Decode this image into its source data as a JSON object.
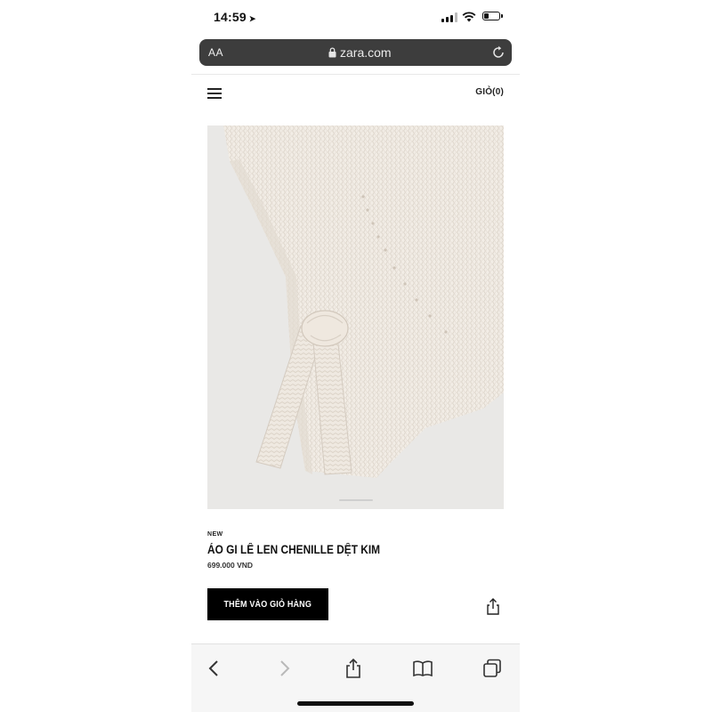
{
  "status_bar": {
    "time": "14:59",
    "signal_bars": 3
  },
  "browser": {
    "aa_label": "AA",
    "domain": "zara.com"
  },
  "header": {
    "menu_icon": "hamburger-menu-icon",
    "cart_label": "GIỎ(0)"
  },
  "product": {
    "image_description_icon": "product-photo",
    "image_index": 1,
    "badge": "NEW",
    "name": "ÁO GI LÊ LEN CHENILLE DỆT KIM",
    "price": "699.000 VND",
    "add_to_cart_label": "THÊM VÀO GIỎ HÀNG",
    "share_icon": "share-icon"
  },
  "toolbar": {
    "items": [
      "back-icon",
      "forward-icon",
      "share-icon",
      "bookmarks-icon",
      "tabs-icon"
    ]
  },
  "colors": {
    "urlbar_bg": "#3d3d3d",
    "button_bg": "#000000",
    "image_bg": "#e9e8e6",
    "knit": "#f1ebe4"
  }
}
